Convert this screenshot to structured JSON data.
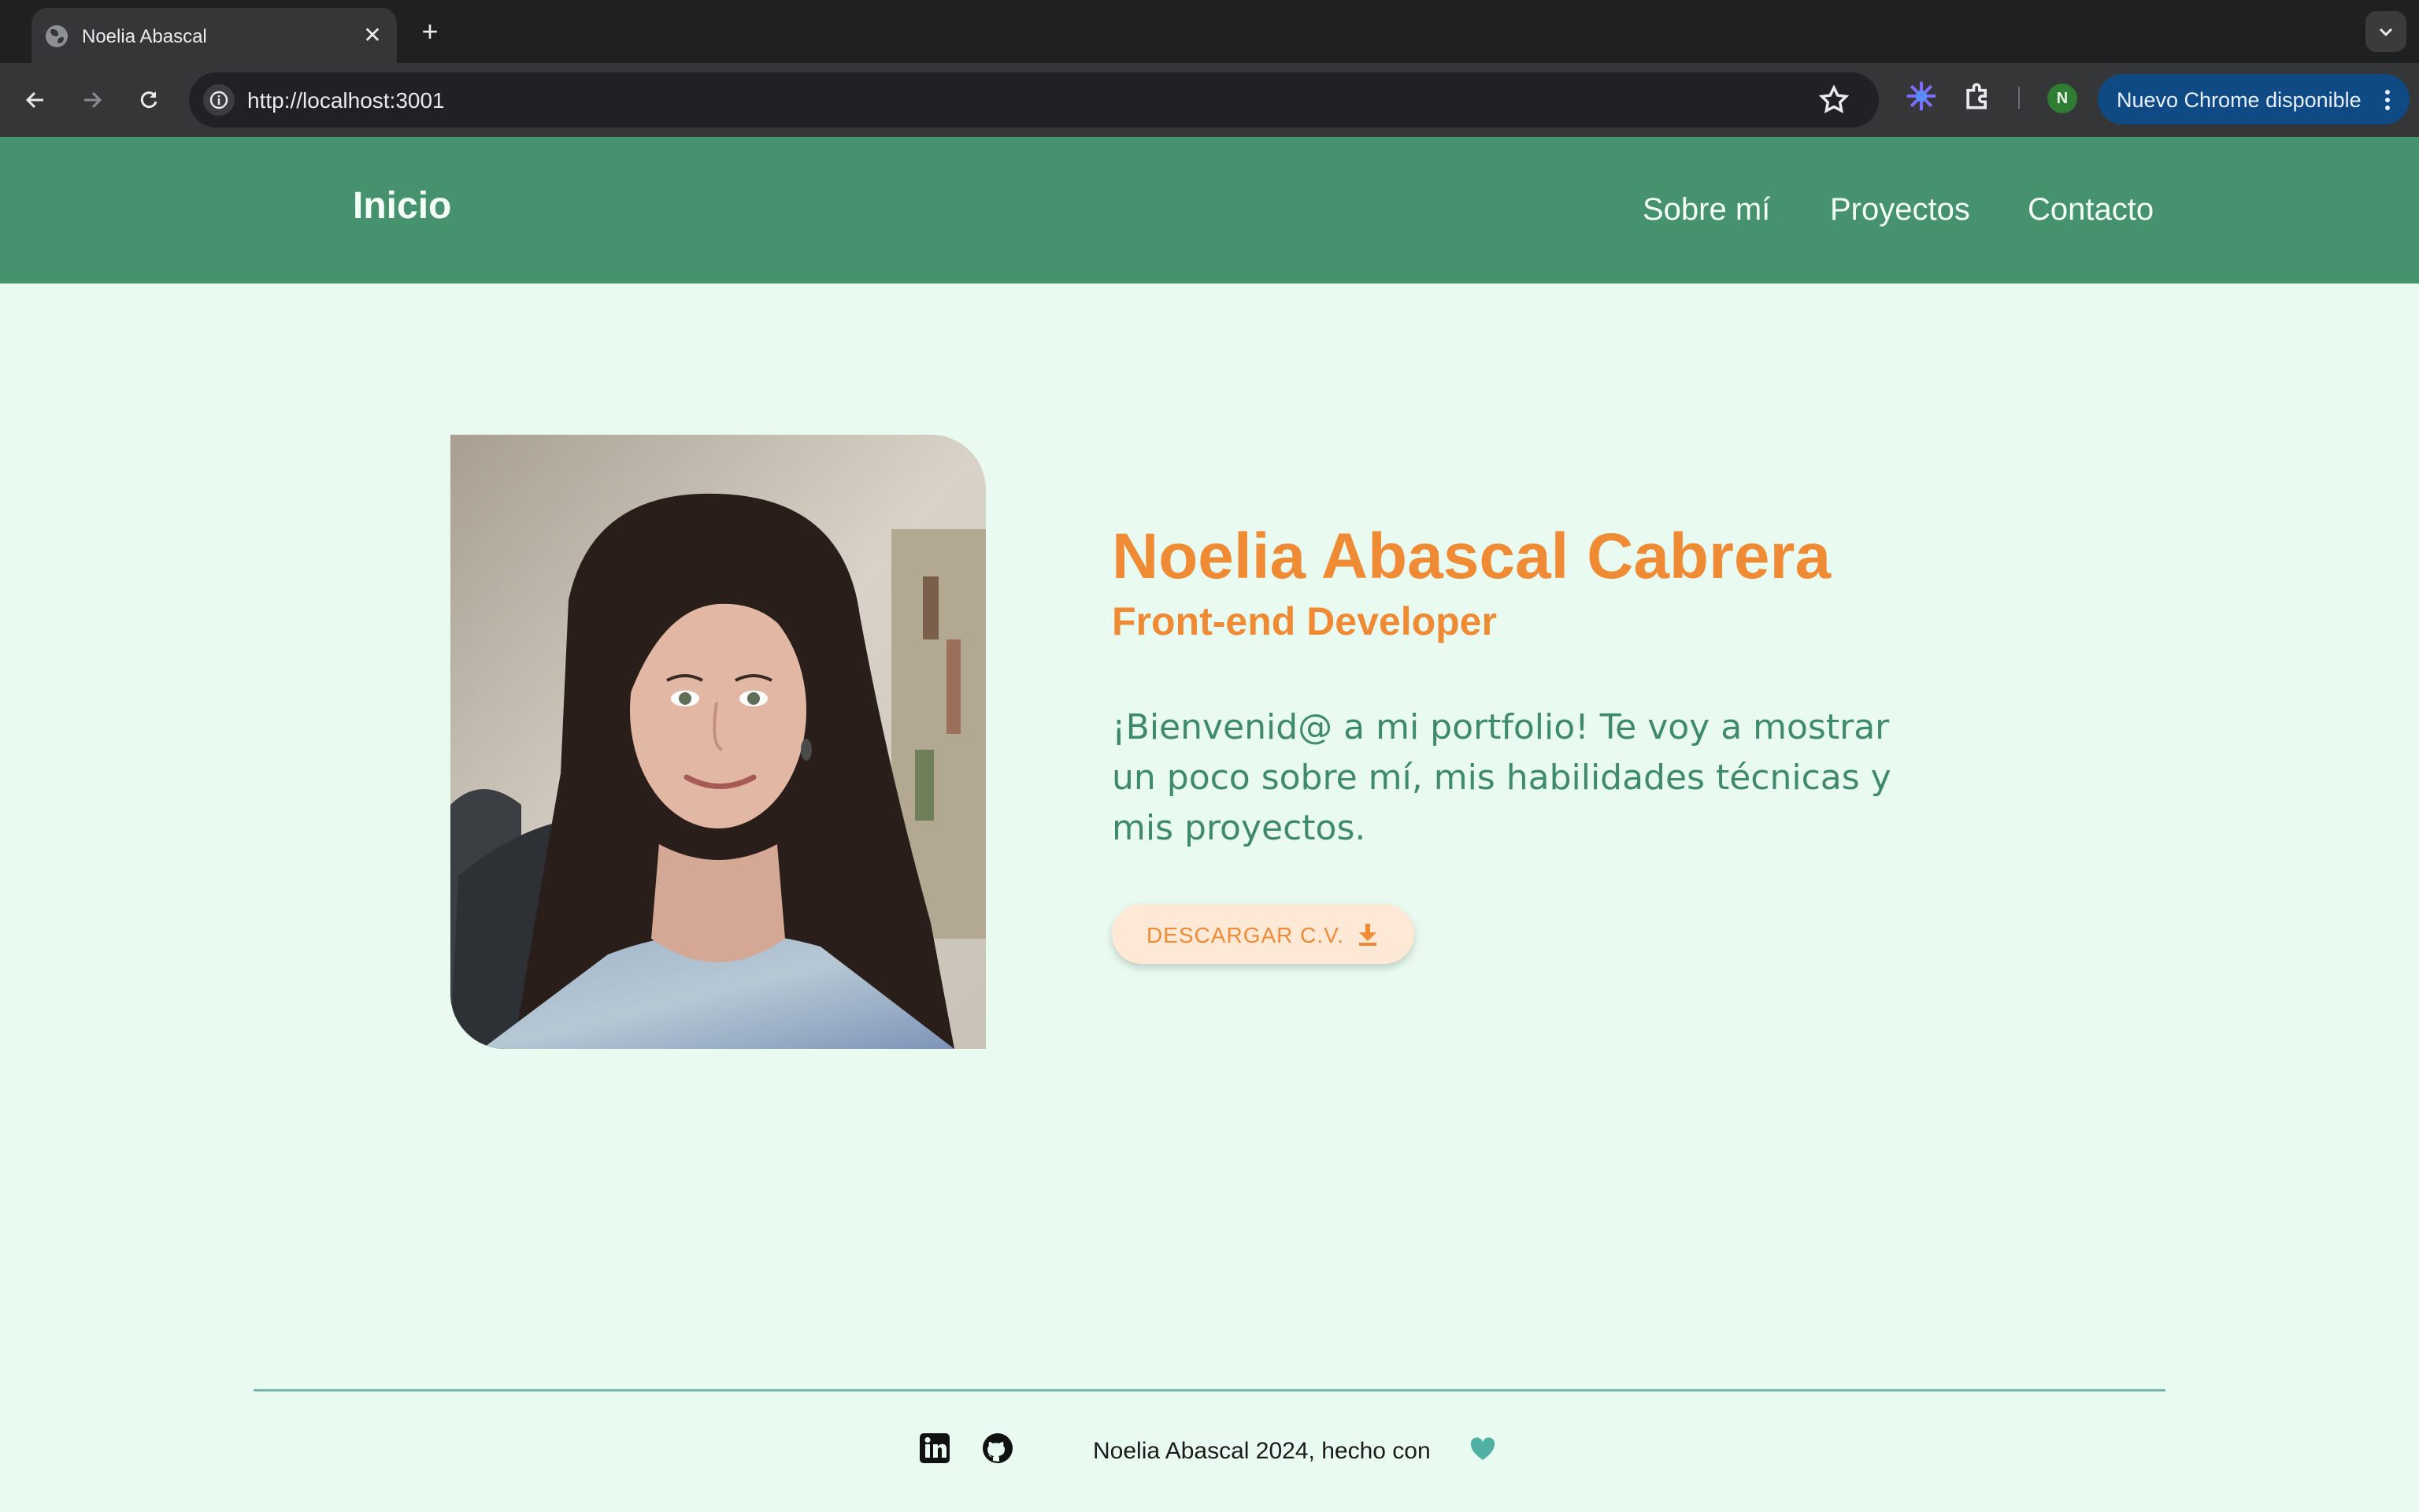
{
  "browser": {
    "tab_title": "Noelia Abascal",
    "url": "http://localhost:3001",
    "profile_initial": "N",
    "update_label": "Nuevo Chrome disponible"
  },
  "site": {
    "logo": "Inicio",
    "nav": [
      "Sobre mí",
      "Proyectos",
      "Contacto"
    ],
    "colors": {
      "header": "#46926e",
      "background": "#e9fbf0",
      "accent": "#ef8b35",
      "body_text": "#3f8a6b"
    }
  },
  "hero": {
    "name": "Noelia Abascal Cabrera",
    "role": "Front-end Developer",
    "intro": "¡Bienvenid@ a mi portfolio! Te voy a mostrar un poco sobre mí, mis habilidades técnicas y mis proyectos.",
    "cv_button": "DESCARGAR C.V.",
    "cv_icon": "download-icon",
    "photo": "portrait-photo"
  },
  "footer": {
    "text": "Noelia Abascal 2024, hecho con",
    "icons": [
      "linkedin-icon",
      "github-icon",
      "heart-icon"
    ]
  }
}
